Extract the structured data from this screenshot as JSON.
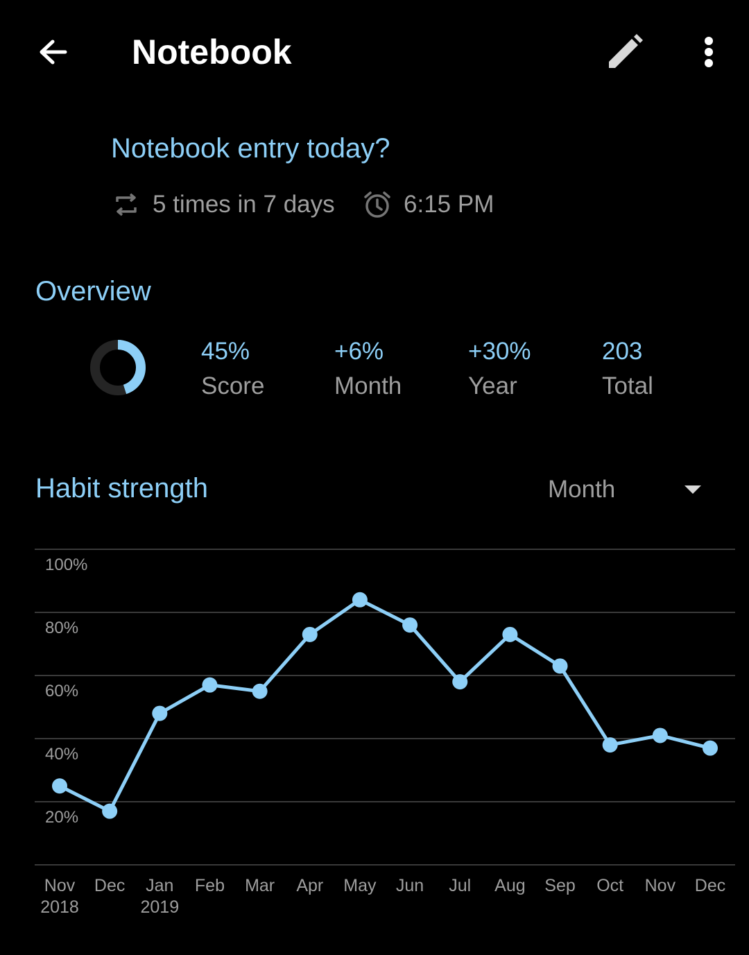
{
  "toolbar": {
    "title": "Notebook",
    "back_icon": "arrow-back-icon",
    "edit_icon": "pencil-icon",
    "more_icon": "more-vert-icon"
  },
  "habit": {
    "question": "Notebook entry today?",
    "frequency": "5 times in 7 days",
    "reminder": "6:15 PM"
  },
  "overview": {
    "title": "Overview",
    "score_ring": 0.45,
    "stats": [
      {
        "value": "45%",
        "label": "Score"
      },
      {
        "value": "+6%",
        "label": "Month"
      },
      {
        "value": "+30%",
        "label": "Year"
      },
      {
        "value": "203",
        "label": "Total"
      }
    ]
  },
  "strength": {
    "title": "Habit strength",
    "period": "Month"
  },
  "colors": {
    "accent": "#8dcff7",
    "muted": "#9e9e9e",
    "background": "#000000",
    "grid": "#3a3a3a"
  },
  "chart_data": {
    "type": "line",
    "ylim": [
      0,
      100
    ],
    "yticks": [
      "20%",
      "40%",
      "60%",
      "80%",
      "100%"
    ],
    "ytick_values": [
      20,
      40,
      60,
      80,
      100
    ],
    "categories": [
      [
        "Nov",
        "2018"
      ],
      [
        "Dec",
        ""
      ],
      [
        "Jan",
        "2019"
      ],
      [
        "Feb",
        ""
      ],
      [
        "Mar",
        ""
      ],
      [
        "Apr",
        ""
      ],
      [
        "May",
        ""
      ],
      [
        "Jun",
        ""
      ],
      [
        "Jul",
        ""
      ],
      [
        "Aug",
        ""
      ],
      [
        "Sep",
        ""
      ],
      [
        "Oct",
        ""
      ],
      [
        "Nov",
        ""
      ],
      [
        "Dec",
        ""
      ]
    ],
    "values": [
      25,
      17,
      48,
      57,
      55,
      73,
      84,
      76,
      58,
      73,
      63,
      38,
      41,
      37
    ]
  }
}
